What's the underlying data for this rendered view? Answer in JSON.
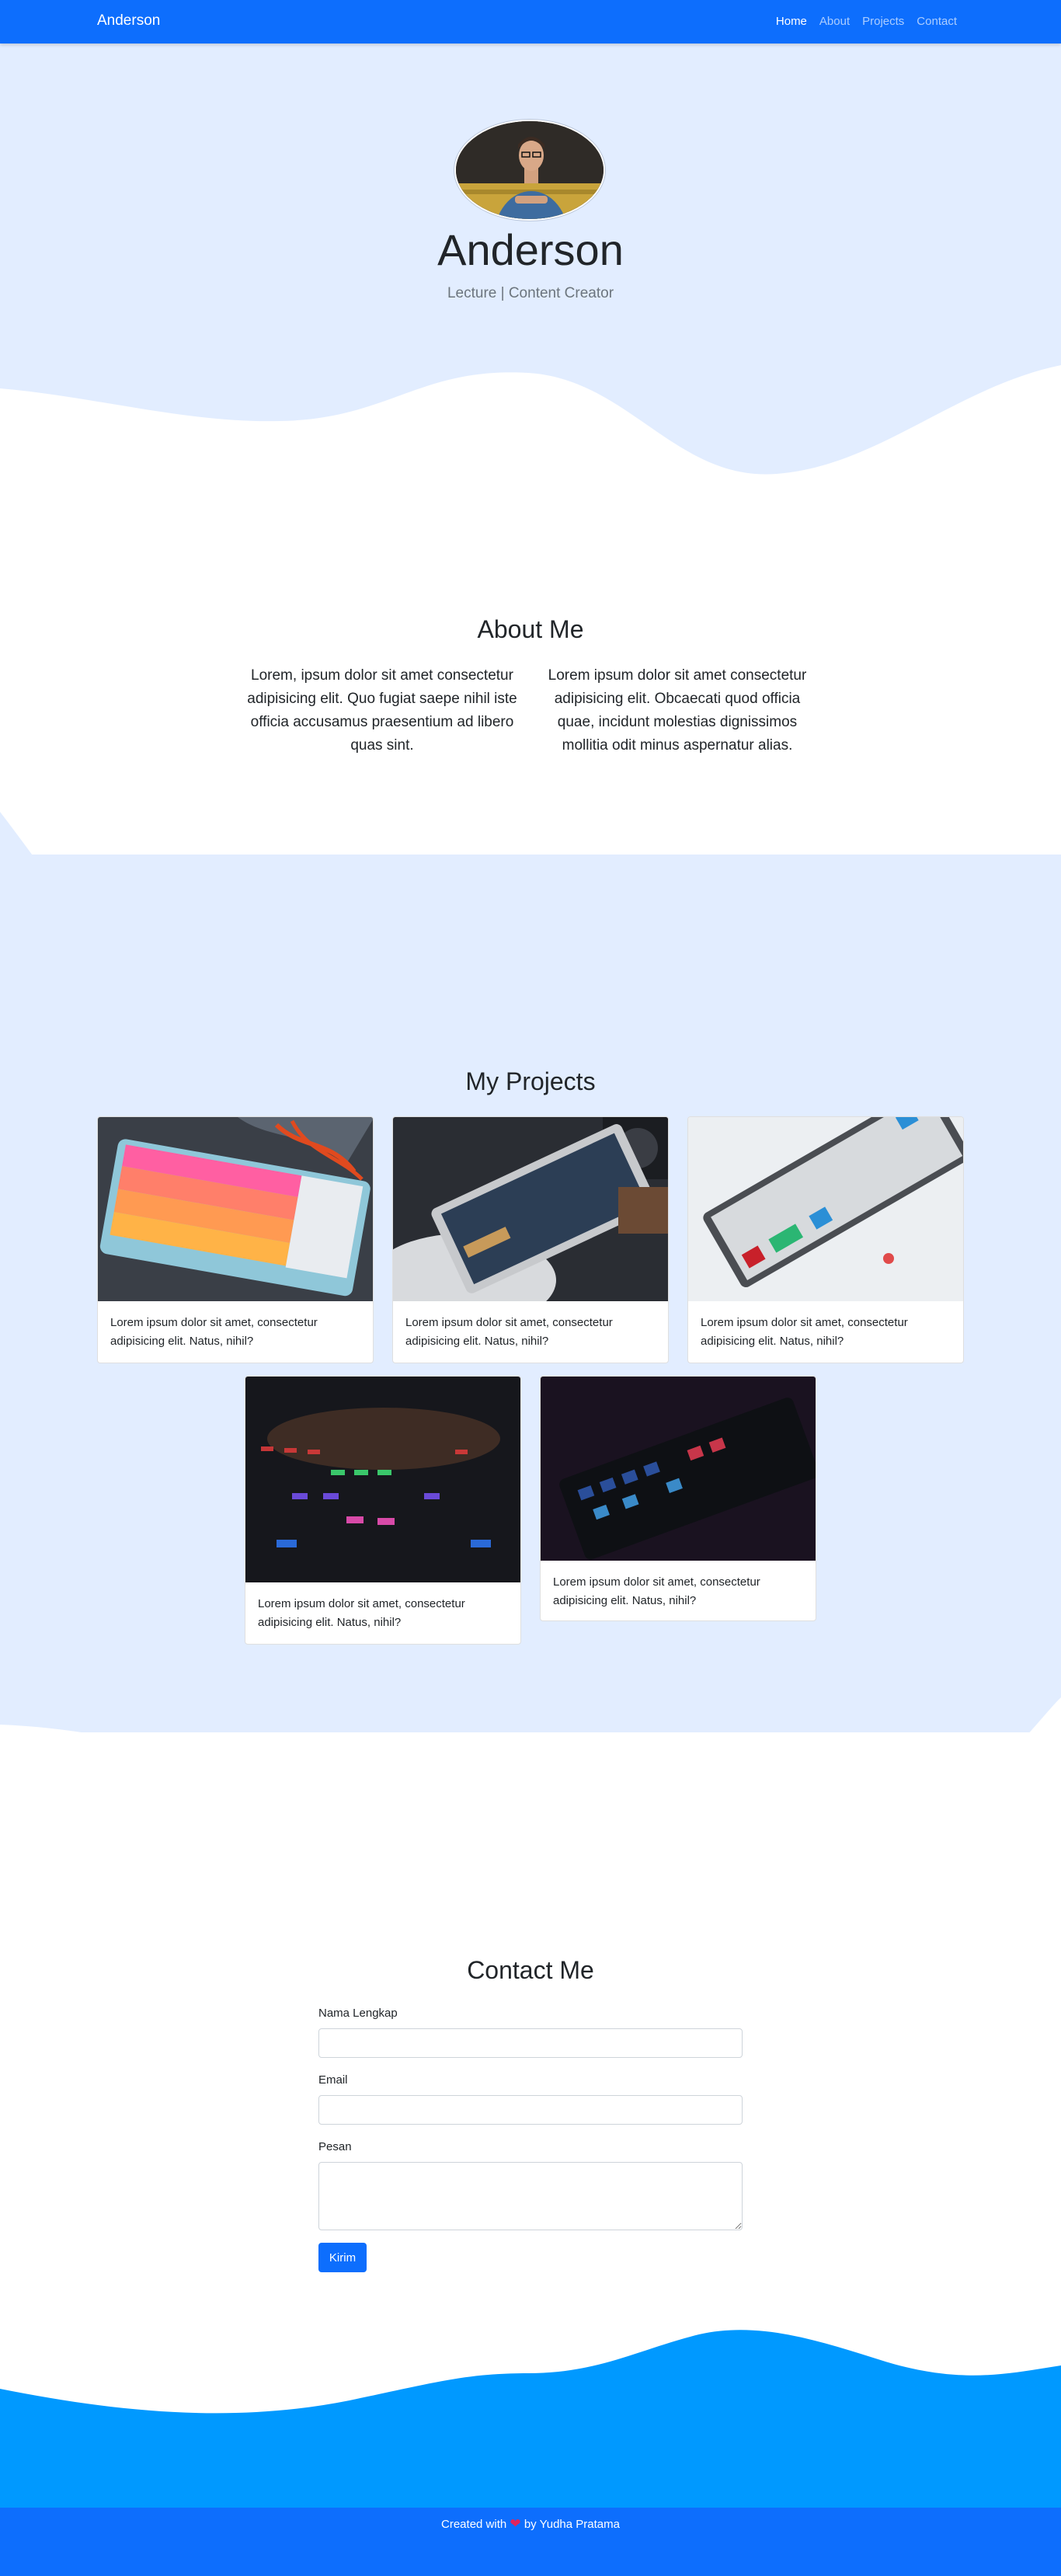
{
  "nav": {
    "brand": "Anderson",
    "links": [
      {
        "label": "Home"
      },
      {
        "label": "About"
      },
      {
        "label": "Projects"
      },
      {
        "label": "Contact"
      }
    ]
  },
  "hero": {
    "name": "Anderson",
    "subtitle": "Lecture | Content Creator"
  },
  "about": {
    "title": "About Me",
    "paragraphs": [
      "Lorem, ipsum dolor sit amet consectetur adipisicing elit. Quo fugiat saepe nihil iste officia accusamus praesentium ad libero quas sint.",
      "Lorem ipsum dolor sit amet consectetur adipisicing elit. Obcaecati quod officia quae, incidunt molestias dignissimos mollitia odit minus aspernatur alias."
    ]
  },
  "projects": {
    "title": "My Projects",
    "cards": [
      {
        "text": "Lorem ipsum dolor sit amet, consectetur adipisicing elit. Natus, nihil?"
      },
      {
        "text": "Lorem ipsum dolor sit amet, consectetur adipisicing elit. Natus, nihil?"
      },
      {
        "text": "Lorem ipsum dolor sit amet, consectetur adipisicing elit. Natus, nihil?"
      },
      {
        "text": "Lorem ipsum dolor sit amet, consectetur adipisicing elit. Natus, nihil?"
      },
      {
        "text": "Lorem ipsum dolor sit amet, consectetur adipisicing elit. Natus, nihil?"
      }
    ]
  },
  "contact": {
    "title": "Contact Me",
    "name_label": "Nama Lengkap",
    "name_value": "",
    "email_label": "Email",
    "email_value": "",
    "message_label": "Pesan",
    "message_value": "",
    "submit_label": "Kirim"
  },
  "footer": {
    "prefix": "Created with",
    "suffix": "by Yudha Pratama",
    "heart_icon": "heart-icon"
  },
  "colors": {
    "primary": "#0d6efd",
    "section_bg": "#e2edff",
    "wave_bottom": "#0099ff",
    "heart": "#e0245e"
  }
}
